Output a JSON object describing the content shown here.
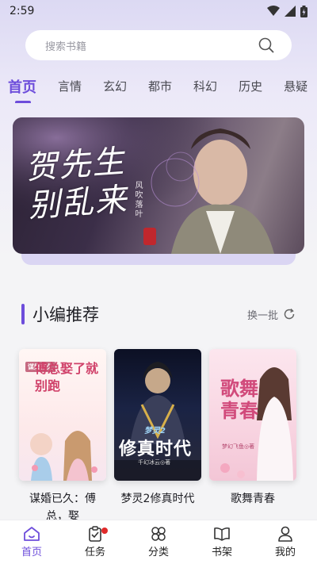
{
  "status": {
    "time": "2:59"
  },
  "search": {
    "placeholder": "搜索书籍"
  },
  "tabs": [
    {
      "label": "首页",
      "active": true
    },
    {
      "label": "言情"
    },
    {
      "label": "玄幻"
    },
    {
      "label": "都市"
    },
    {
      "label": "科幻"
    },
    {
      "label": "历史"
    },
    {
      "label": "悬疑"
    }
  ],
  "banner": {
    "title_line1": "贺先生",
    "title_line2": "别乱来",
    "subtitle": "风吹落叶"
  },
  "section": {
    "title": "小编推荐",
    "refresh_label": "换一批"
  },
  "books": [
    {
      "title": "谋婚已久：傅总，娶",
      "cover_text": "傅总娶了就别跑",
      "cover_badge": "谋婚已久"
    },
    {
      "title": "梦灵2修真时代",
      "cover_text": "修真时代",
      "cover_badge": "梦灵2",
      "cover_author": "千幻冰云◎著"
    },
    {
      "title": "歌舞青春",
      "cover_text": "歌舞青春",
      "cover_author": "梦幻飞鱼◎著"
    }
  ],
  "nav": [
    {
      "label": "首页",
      "active": true
    },
    {
      "label": "任务",
      "badge": true
    },
    {
      "label": "分类"
    },
    {
      "label": "书架"
    },
    {
      "label": "我的"
    }
  ],
  "colors": {
    "accent": "#6d4ddb",
    "badge": "#e02a2a"
  }
}
